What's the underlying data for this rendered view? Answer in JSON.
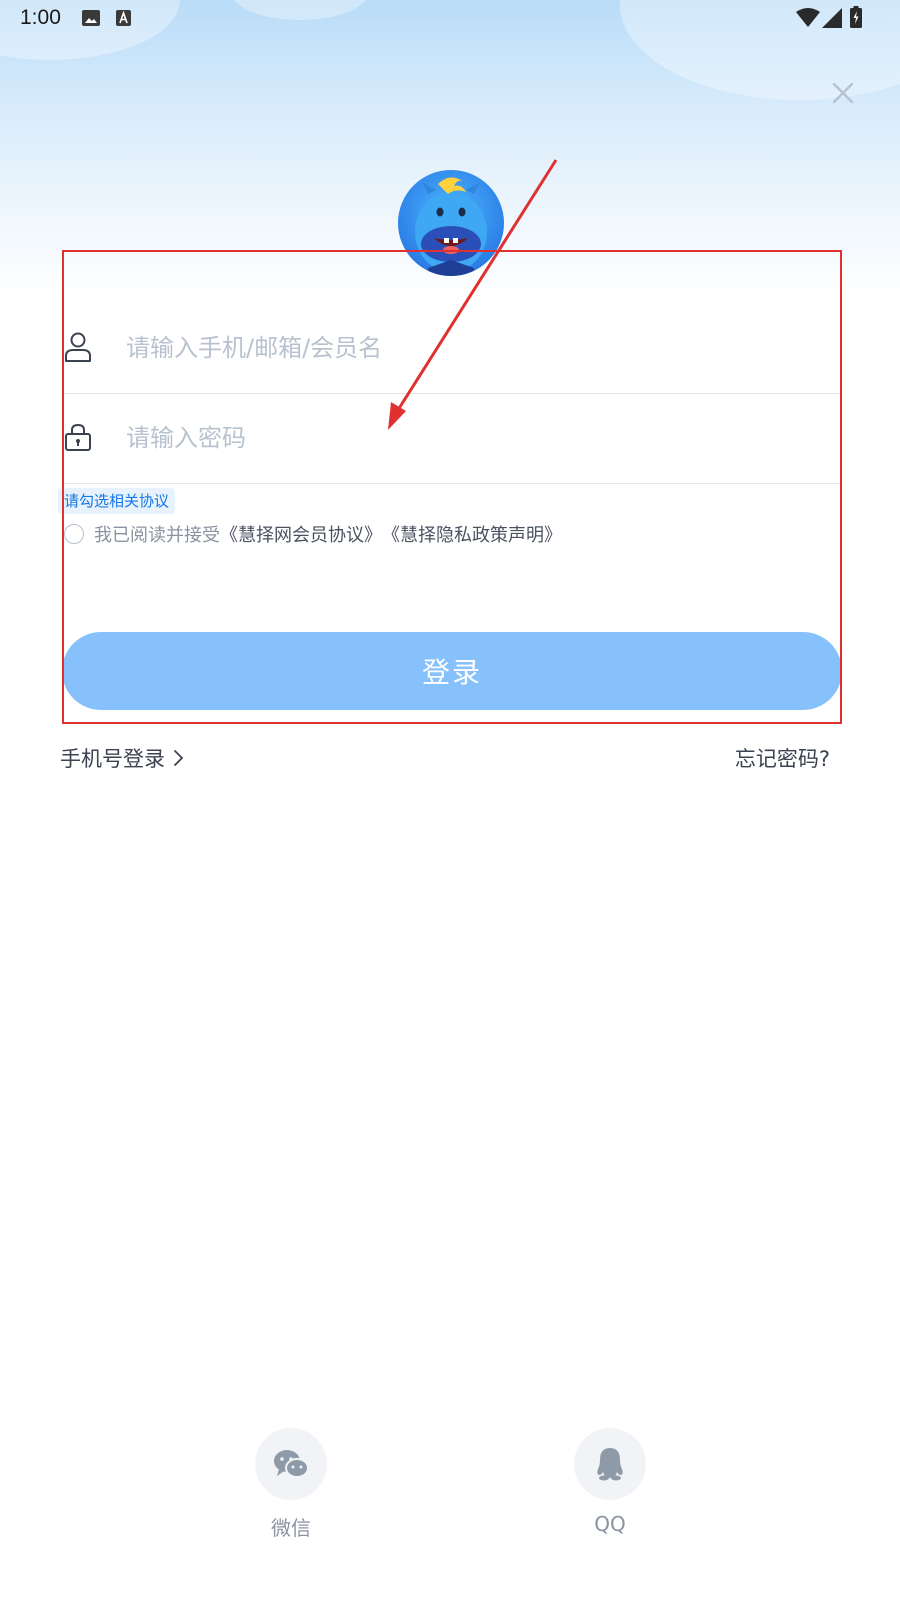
{
  "status_bar": {
    "time": "1:00"
  },
  "form": {
    "username_placeholder": "请输入手机/邮箱/会员名",
    "password_placeholder": "请输入密码",
    "agreement_hint": "请勾选相关协议",
    "agreement_prefix": "我已阅读并接受",
    "agreement_link_member": "《慧择网会员协议》",
    "agreement_link_privacy": "《慧择隐私政策声明》",
    "login_label": "登录"
  },
  "links": {
    "phone_login": "手机号登录",
    "forgot_password": "忘记密码?"
  },
  "social": {
    "wechat_label": "微信",
    "qq_label": "QQ"
  },
  "icons": {
    "close": "close-icon",
    "user": "user-icon",
    "lock": "lock-icon",
    "wechat": "wechat-icon",
    "qq": "qq-icon"
  },
  "colors": {
    "primary_button": "#86c1fb",
    "hint_text": "#1677e6",
    "annotation": "#e03131"
  }
}
